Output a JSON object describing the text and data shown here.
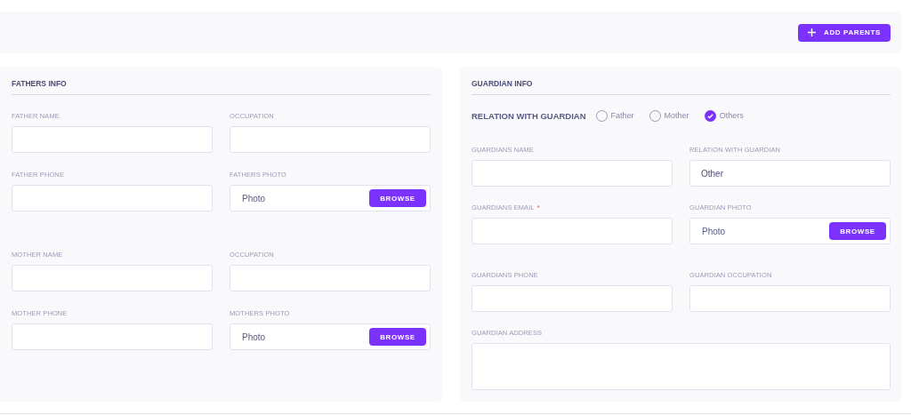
{
  "toolbar": {
    "add_button": {
      "label": "ADD PARENTS"
    }
  },
  "fathers_info": {
    "title": "FATHERS INFO",
    "groups": [
      {
        "fields": [
          {
            "kind": "text",
            "label": "FATHER NAME"
          },
          {
            "kind": "text",
            "label": "OCCUPATION"
          },
          {
            "kind": "text",
            "label": "FATHER PHONE"
          },
          {
            "kind": "file",
            "label": "FATHERS PHOTO",
            "value": "Photo",
            "button": "BROWSE"
          }
        ]
      },
      {
        "fields": [
          {
            "kind": "text",
            "label": "MOTHER NAME"
          },
          {
            "kind": "text",
            "label": "OCCUPATION"
          },
          {
            "kind": "text",
            "label": "MOTHER PHONE"
          },
          {
            "kind": "file",
            "label": "MOTHERS PHOTO",
            "value": "Photo",
            "button": "BROWSE"
          }
        ]
      }
    ]
  },
  "guardian_info": {
    "title": "GUARDIAN INFO",
    "relation": {
      "label": "RELATION WITH GUARDIAN",
      "options": [
        {
          "label": "Father",
          "selected": false
        },
        {
          "label": "Mother",
          "selected": false
        },
        {
          "label": "Others",
          "selected": true
        }
      ]
    },
    "groups": [
      {
        "fields": [
          {
            "kind": "text",
            "label": "GUARDIANS NAME"
          },
          {
            "kind": "text",
            "label": "RELATION WITH GUARDIAN",
            "value": "Other"
          },
          {
            "kind": "text",
            "label": "GUARDIANS EMAIL",
            "required_mark": "*"
          },
          {
            "kind": "file",
            "label": "GUARDIAN PHOTO",
            "value": "Photo",
            "button": "BROWSE"
          }
        ]
      },
      {
        "fields": [
          {
            "kind": "text",
            "label": "GUARDIANS PHONE"
          },
          {
            "kind": "text",
            "label": "GUARDIAN OCCUPATION"
          },
          {
            "kind": "textarea",
            "label": "GUARDIAN ADDRESS"
          }
        ]
      }
    ]
  }
}
